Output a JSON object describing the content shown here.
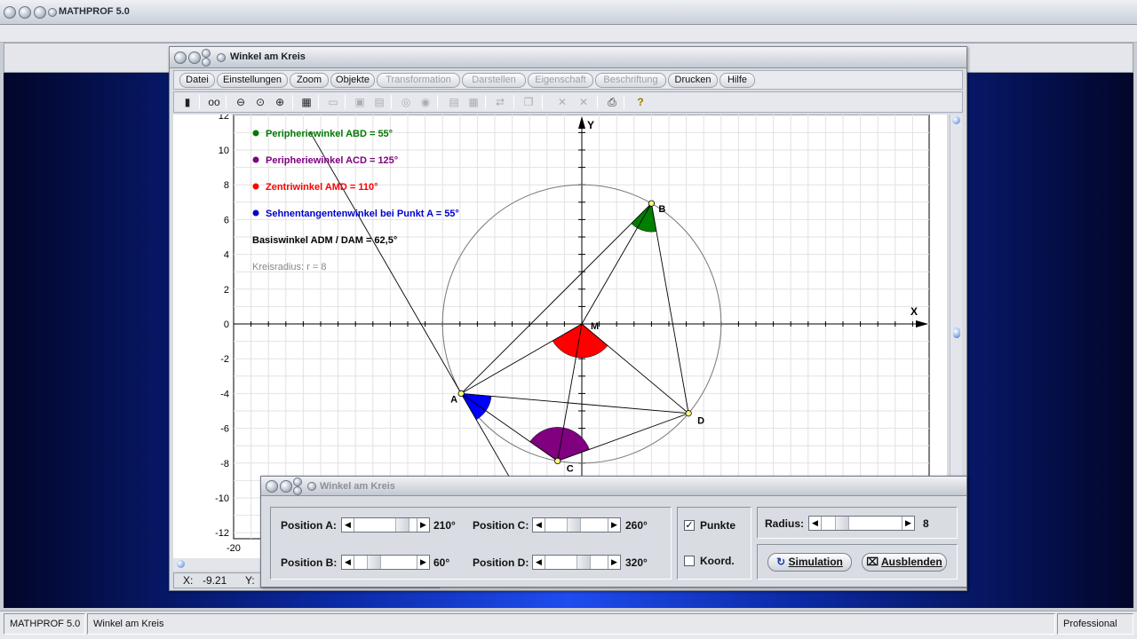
{
  "app": {
    "title": "MATHPROF 5.0"
  },
  "window": {
    "title": "Winkel am Kreis"
  },
  "menu": [
    {
      "label": "Datei",
      "enabled": true
    },
    {
      "label": "Einstellungen",
      "enabled": true
    },
    {
      "label": "Zoom",
      "enabled": true
    },
    {
      "label": "Objekte",
      "enabled": true
    },
    {
      "label": "Transformation",
      "enabled": false
    },
    {
      "label": "Darstellen",
      "enabled": false
    },
    {
      "label": "Eigenschaft",
      "enabled": false
    },
    {
      "label": "Beschriftung",
      "enabled": false
    },
    {
      "label": "Drucken",
      "enabled": true
    },
    {
      "label": "Hilfe",
      "enabled": true
    }
  ],
  "toolbar": {
    "icons": [
      "calculator-icon",
      "glasses-icon",
      "zoom-out-icon",
      "zoom-default-icon",
      "zoom-in-icon",
      "settings-icon",
      "window-icon",
      "grid-icon",
      "grid-icon",
      "circle-icon",
      "circle-icon",
      "table-icon",
      "table-icon",
      "export-icon",
      "copy-icon",
      "close-icon",
      "close-icon",
      "print-icon",
      "help-icon"
    ]
  },
  "plot": {
    "legend": [
      {
        "text": "Peripheriewinkel ABD = 55°",
        "color": "#007a00"
      },
      {
        "text": "Peripheriewinkel ACD = 125°",
        "color": "#800080"
      },
      {
        "text": "Zentriwinkel AMD = 110°",
        "color": "#ff0000"
      },
      {
        "text": "Sehnentangentenwinkel bei Punkt A = 55°",
        "color": "#0000cc"
      }
    ],
    "basiswinkel": "Basiswinkel ADM / DAM = 62,5°",
    "radius_text": "Kreisradius:  r  = 8",
    "x_axis_label": "X",
    "y_axis_label": "Y",
    "x_tick_label": "-20",
    "y_tick_labels": [
      "12",
      "10",
      "8",
      "6",
      "4",
      "2",
      "0",
      "-2",
      "-4",
      "-6",
      "-8",
      "-10",
      "-12"
    ],
    "points": [
      {
        "name": "A",
        "x": -6.93,
        "y": -4
      },
      {
        "name": "B",
        "x": 4,
        "y": 6.93
      },
      {
        "name": "C",
        "x": -1.39,
        "y": -7.88
      },
      {
        "name": "D",
        "x": 6.13,
        "y": -5.14
      },
      {
        "name": "M",
        "x": 0,
        "y": 0
      }
    ],
    "circle_radius": 8
  },
  "coords": {
    "x_label": "X:",
    "x_value": "-9.21",
    "y_label": "Y:"
  },
  "control": {
    "title": "Winkel am Kreis",
    "position_a": {
      "label": "Position A:",
      "value": "210°",
      "level": 0.85
    },
    "position_b": {
      "label": "Position B:",
      "value": "60°",
      "level": 0.25
    },
    "position_c": {
      "label": "Position C:",
      "value": "260°",
      "level": 0.45
    },
    "position_d": {
      "label": "Position D:",
      "value": "320°",
      "level": 0.65
    },
    "punkte": {
      "label": "Punkte",
      "checked": "✓"
    },
    "koord": {
      "label": "Koord.",
      "checked": ""
    },
    "radius": {
      "label": "Radius:",
      "value": "8",
      "level": 0.2
    },
    "simulation_button": "Simulation",
    "ausblenden_button": "Ausblenden"
  },
  "statusbar": {
    "app": "MATHPROF 5.0",
    "module": "Winkel am Kreis",
    "edition": "Professional"
  }
}
